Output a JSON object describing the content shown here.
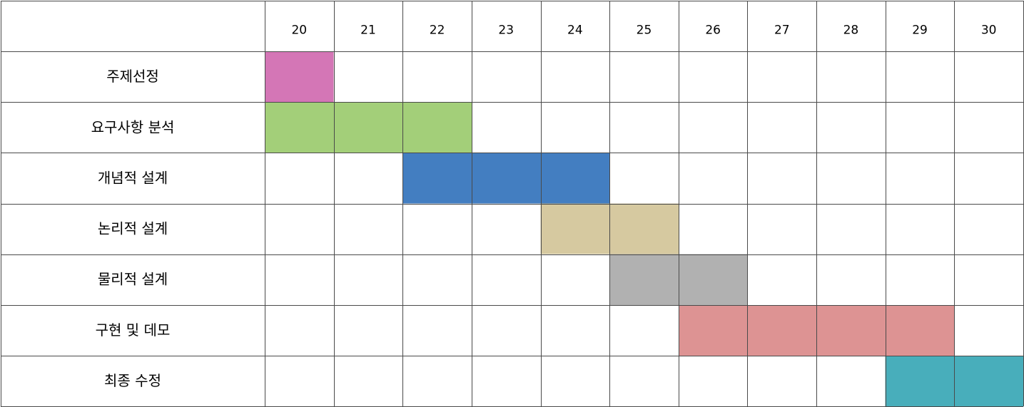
{
  "chart_data": {
    "type": "table",
    "days": [
      20,
      21,
      22,
      23,
      24,
      25,
      26,
      27,
      28,
      29,
      30
    ],
    "tasks": [
      {
        "name": "주제선정",
        "start": 20,
        "end": 20,
        "color": "#d476b6"
      },
      {
        "name": "요구사항 분석",
        "start": 20,
        "end": 22,
        "color": "#a3cf79"
      },
      {
        "name": "개념적 설계",
        "start": 22,
        "end": 24,
        "color": "#437ec1"
      },
      {
        "name": "논리적 설계",
        "start": 24,
        "end": 25,
        "color": "#d6c9a0"
      },
      {
        "name": "물리적 설계",
        "start": 25,
        "end": 26,
        "color": "#b1b1b1"
      },
      {
        "name": "구현 및 데모",
        "start": 26,
        "end": 29,
        "color": "#dd9393"
      },
      {
        "name": "최종 수정",
        "start": 29,
        "end": 30,
        "color": "#48aebb"
      }
    ],
    "grid": true,
    "grid_color": "#4a4a4a",
    "background": "#ffffff"
  }
}
